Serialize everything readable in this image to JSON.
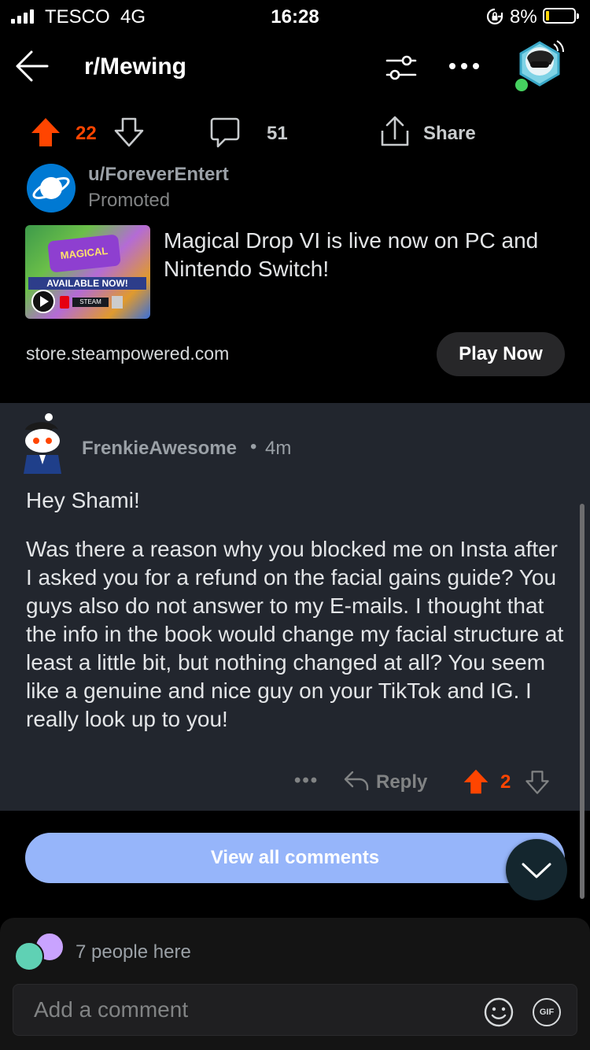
{
  "status_bar": {
    "carrier": "TESCO",
    "network": "4G",
    "time": "16:28",
    "battery_percent": "8%",
    "battery_level": 0.08
  },
  "header": {
    "back_icon": "arrow-left-icon",
    "title": "r/Mewing",
    "sort_icon": "sliders-icon",
    "more_icon": "more-horizontal-icon",
    "avatar_status_color": "#46d160"
  },
  "post_actions": {
    "upvote_count": "22",
    "comment_count": "51",
    "share_label": "Share",
    "upvote_color": "#ff4500"
  },
  "promoted": {
    "username": "u/ForeverEntert",
    "tag": "Promoted",
    "headline": "Magical Drop VI is live now on PC and Nintendo Switch!",
    "thumbnail_text": {
      "game_title": "MAGICAL DROP",
      "banner": "AVAILABLE NOW!",
      "store": "STEAM"
    },
    "domain": "store.steampowered.com",
    "cta_label": "Play Now"
  },
  "comment": {
    "author": "FrenkieAwesome",
    "separator": "•",
    "age": "4m",
    "body": [
      "Hey Shami!",
      "Was there a reason why you blocked me on Insta after I asked you for a refund on the facial gains guide? You guys also do not answer to my E-mails. I thought that the info in the book would change my facial structure at least a little bit, but nothing changed at all? You seem like a genuine and nice guy on your TikTok and IG. I really look up to you!"
    ],
    "more_label": "•••",
    "reply_label": "Reply",
    "vote_count": "2"
  },
  "view_all_label": "View all comments",
  "presence": {
    "text": "7 people here"
  },
  "composer": {
    "placeholder": "Add a comment",
    "gif_label": "GIF"
  }
}
